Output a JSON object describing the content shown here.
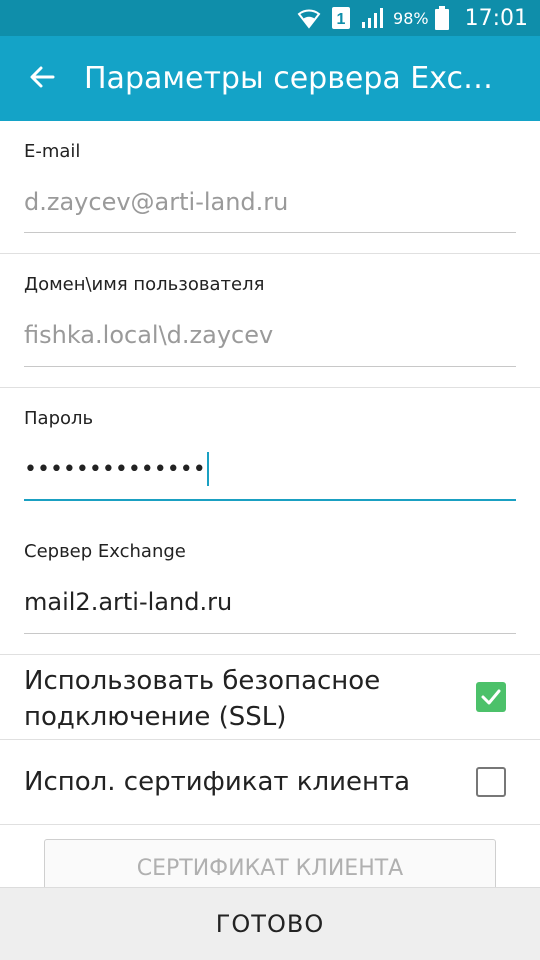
{
  "status_bar": {
    "battery_percent": "98%",
    "time": "17:01",
    "sim_slot": "1",
    "icons": [
      "wifi-icon",
      "sim-icon",
      "signal-icon",
      "battery-icon"
    ]
  },
  "app_bar": {
    "title": "Параметры сервера Exchange",
    "back_icon": "back-arrow-icon"
  },
  "form": {
    "email": {
      "label": "E-mail",
      "value": "d.zaycev@arti-land.ru"
    },
    "domain_user": {
      "label": "Домен\\имя пользователя",
      "value": "fishka.local\\d.zaycev"
    },
    "password": {
      "label": "Пароль",
      "value": "••••••••••••••"
    },
    "exchange_server": {
      "label": "Сервер Exchange",
      "value": "mail2.arti-land.ru"
    }
  },
  "options": {
    "ssl": {
      "label": "Использовать безопасное подключение (SSL)",
      "checked": true
    },
    "client_cert": {
      "label": "Испол. сертификат клиента",
      "checked": false
    }
  },
  "client_cert_button": {
    "label": "СЕРТИФИКАТ КЛИЕНТА"
  },
  "bottom_action": {
    "label": "ГОТОВО"
  },
  "colors": {
    "status_bar": "#0f8eaa",
    "app_bar": "#14a3c7",
    "accent": "#1aa0c2",
    "checkbox_on": "#4cc16a"
  }
}
